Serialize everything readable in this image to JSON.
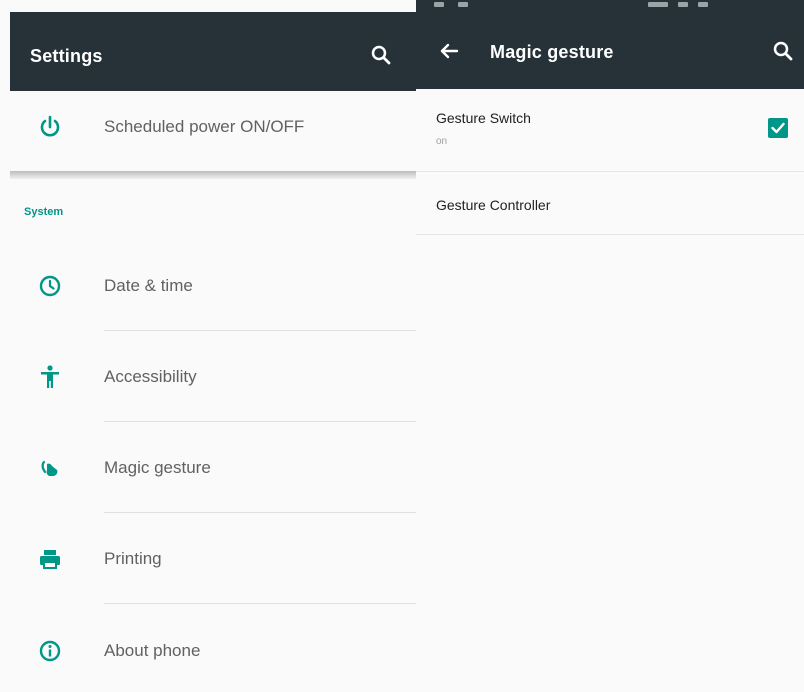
{
  "colors": {
    "toolbar": "#263238",
    "accent": "#009688",
    "label": "#616161"
  },
  "left": {
    "title": "Settings",
    "search_icon": "search-icon",
    "top_item": {
      "label": "Scheduled power ON/OFF",
      "icon": "power-icon"
    },
    "section_header": "System",
    "items": [
      {
        "label": "Date & time",
        "icon": "clock-icon"
      },
      {
        "label": "Accessibility",
        "icon": "accessibility-icon"
      },
      {
        "label": "Magic gesture",
        "icon": "gesture-hand-icon"
      },
      {
        "label": "Printing",
        "icon": "printer-icon"
      },
      {
        "label": "About phone",
        "icon": "info-icon"
      }
    ]
  },
  "right": {
    "title": "Magic gesture",
    "back_icon": "back-arrow-icon",
    "search_icon": "search-icon",
    "preferences": [
      {
        "title": "Gesture Switch",
        "summary": "on",
        "checked": true
      },
      {
        "title": "Gesture Controller"
      }
    ]
  }
}
